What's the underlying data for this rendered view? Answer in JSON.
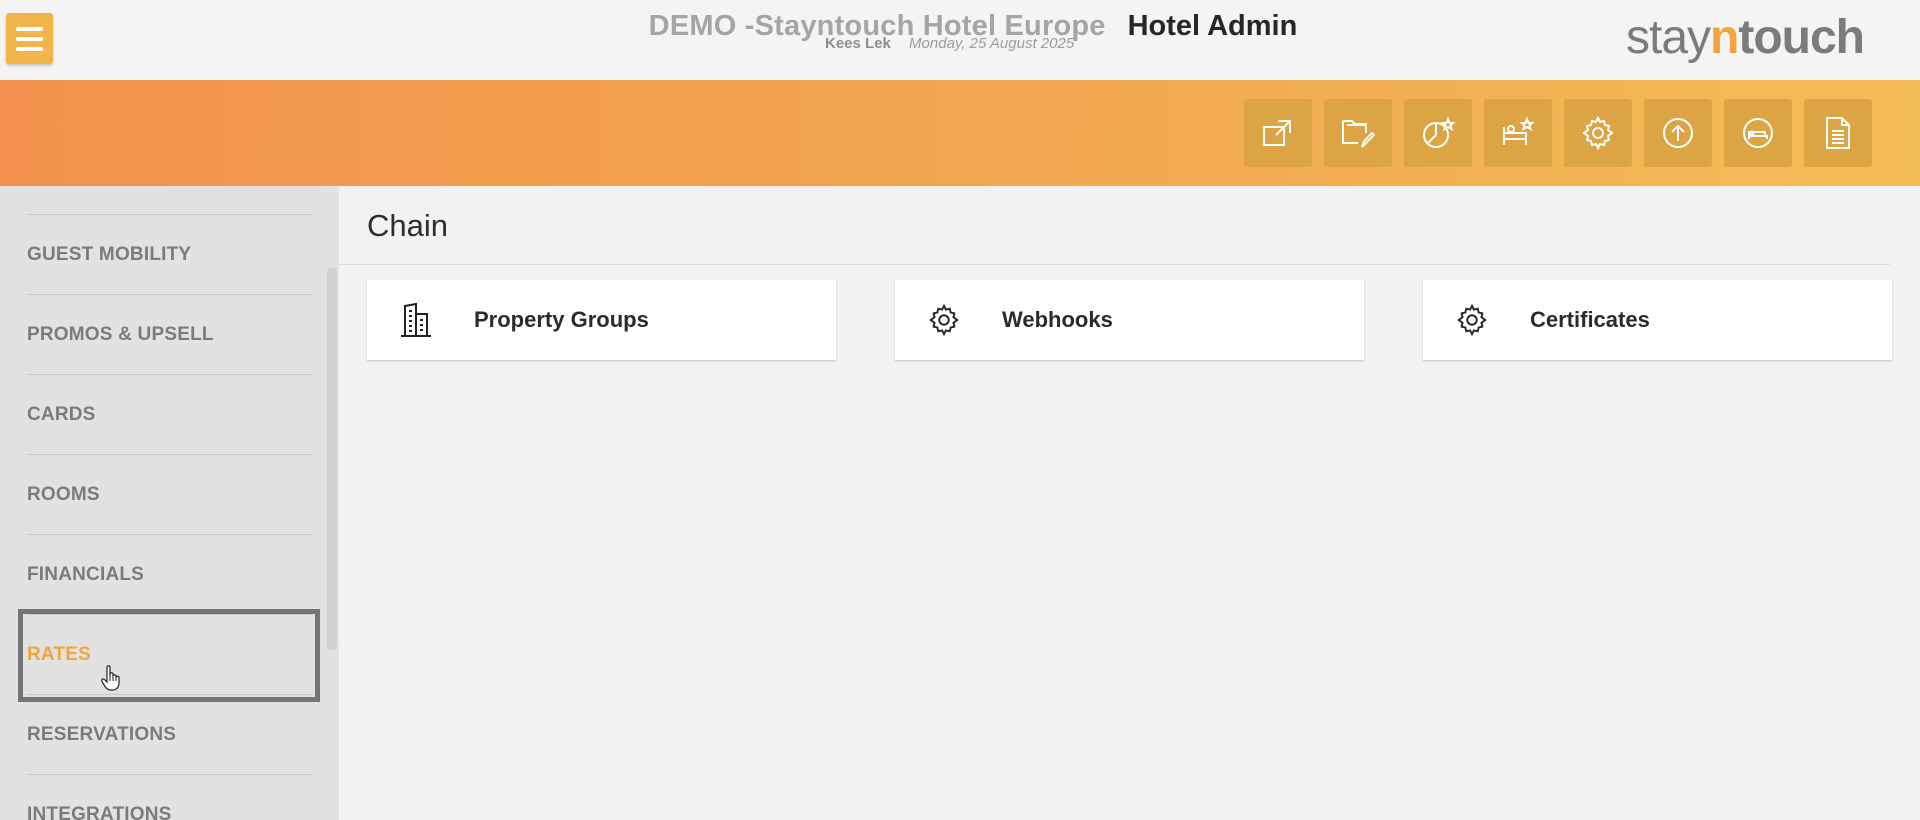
{
  "header": {
    "menu_icon": "hamburger-icon",
    "hotel_name": "DEMO -Stayntouch Hotel Europe",
    "app_name": "Hotel Admin",
    "user_name": "Kees Lek",
    "date": "Monday, 25 August 2025",
    "brand": {
      "stay": "stay",
      "n": "n",
      "touch": "touch"
    },
    "brand_accent": "#f3a43c"
  },
  "toolbar": {
    "buttons": [
      {
        "icon": "external-link-icon"
      },
      {
        "icon": "folder-edit-icon"
      },
      {
        "icon": "chart-star-icon"
      },
      {
        "icon": "housekeeping-star-icon"
      },
      {
        "icon": "settings-gear-icon"
      },
      {
        "icon": "upload-circle-icon"
      },
      {
        "icon": "bed-circle-icon"
      },
      {
        "icon": "document-icon"
      }
    ]
  },
  "sidebar": {
    "items": [
      {
        "label": "GUEST MOBILITY"
      },
      {
        "label": "PROMOS & UPSELL"
      },
      {
        "label": "CARDS"
      },
      {
        "label": "ROOMS"
      },
      {
        "label": "FINANCIALS"
      },
      {
        "label": "RATES",
        "active": true
      },
      {
        "label": "RESERVATIONS"
      },
      {
        "label": "INTEGRATIONS"
      }
    ]
  },
  "main": {
    "title": "Chain",
    "cards": [
      {
        "label": "Property Groups",
        "icon": "building-icon"
      },
      {
        "label": "Webhooks",
        "icon": "gear-icon"
      },
      {
        "label": "Certificates",
        "icon": "gear-icon"
      }
    ]
  },
  "colors": {
    "accent": "#f3b54a",
    "orange_start": "#f2924c",
    "orange_end": "#f4bc57",
    "toolbar_button": "#dda443"
  }
}
